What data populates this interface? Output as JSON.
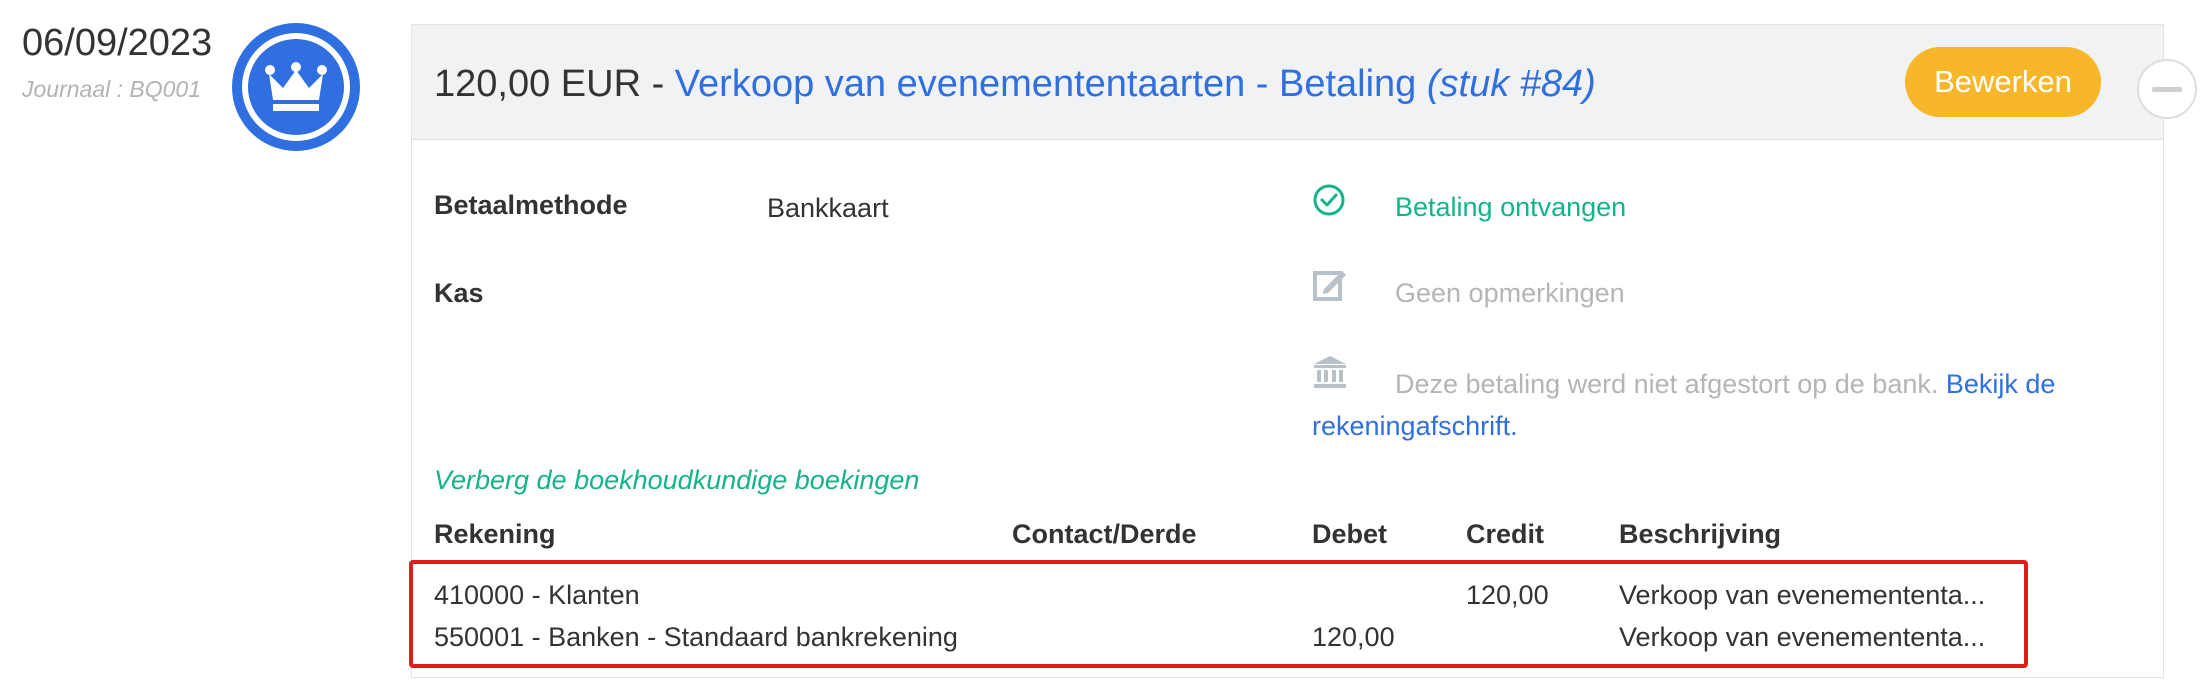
{
  "entry": {
    "date": "06/09/2023",
    "journal": "Journaal : BQ001"
  },
  "header": {
    "amount": "120,00 EUR",
    "separator": " - ",
    "description": "Verkoop van evenemententaarten - Betaling",
    "piece": "(stuk #84)",
    "edit_label": "Bewerken"
  },
  "details": {
    "payment_method_label": "Betaalmethode",
    "payment_method_value": "Bankkaart",
    "cash_label": "Kas"
  },
  "status": {
    "payment_received": "Betaling ontvangen",
    "remarks": "Geen opmerkingen",
    "bank_note": "Deze betaling werd niet afgestort op de bank.",
    "bank_link": "Bekijk de rekeningafschrift",
    "bank_link_end": "."
  },
  "ledger": {
    "toggle_label": "Verberg de boekhoudkundige boekingen",
    "columns": {
      "account": "Rekening",
      "contact": "Contact/Derde",
      "debit": "Debet",
      "credit": "Credit",
      "description": "Beschrijving"
    },
    "rows": [
      {
        "account": "410000 - Klanten",
        "contact": "",
        "debit": "",
        "credit": "120,00",
        "description": "Verkoop van evenemententa..."
      },
      {
        "account": "550001 - Banken - Standaard bankrekening",
        "contact": "",
        "debit": "120,00",
        "credit": "",
        "description": "Verkoop van evenemententa..."
      }
    ]
  },
  "icons": {
    "avatar": "crown-icon",
    "payment_status": "check-circle-icon",
    "remarks": "edit-note-icon",
    "bank": "bank-icon",
    "collapse": "minus-circle-icon"
  },
  "colors": {
    "brand_blue": "#2f6fe0",
    "accent_yellow": "#f8b72b",
    "success_green": "#14b38c",
    "highlight_red": "#e21b1b"
  }
}
